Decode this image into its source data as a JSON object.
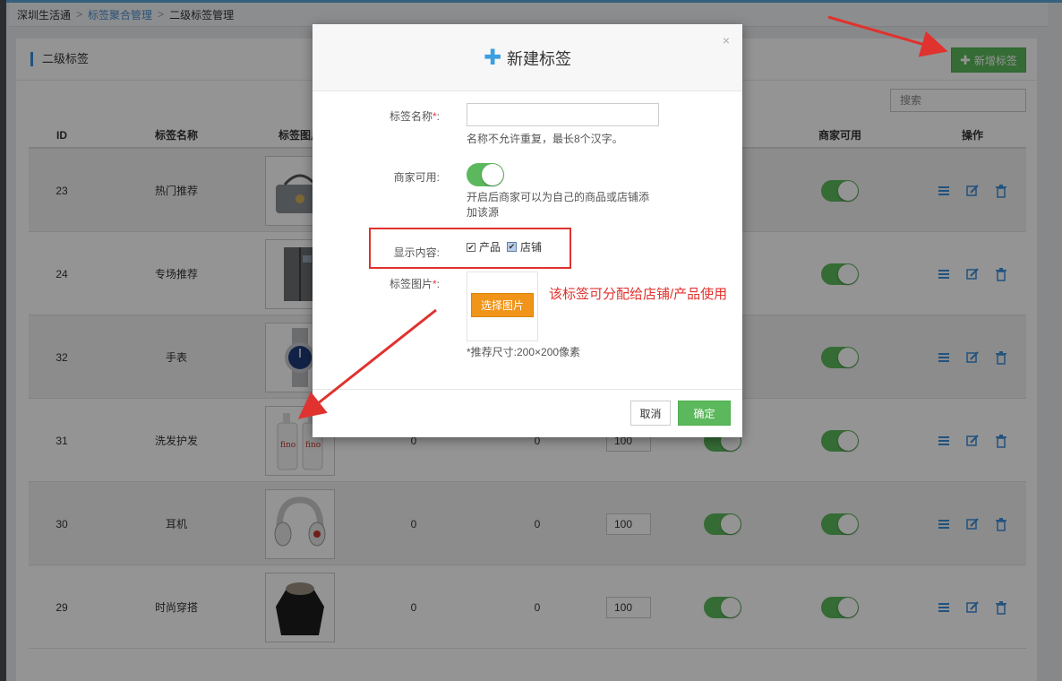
{
  "breadcrumb": {
    "items": [
      "深圳生活通",
      "标签聚合管理",
      "二级标签管理"
    ],
    "separator": ">"
  },
  "panel": {
    "title": "二级标签",
    "add_button": "新增标签",
    "search_placeholder": "搜索"
  },
  "table": {
    "headers": {
      "id": "ID",
      "name": "标签名称",
      "image": "标签图片",
      "merchant": "商家可用",
      "ops": "操作"
    },
    "rows": [
      {
        "id": "23",
        "name": "热门推荐",
        "image_icon": "handbag-image",
        "c1": "",
        "c2": "",
        "sort": "",
        "toggle1": true,
        "toggle2": true
      },
      {
        "id": "24",
        "name": "专场推荐",
        "image_icon": "refrigerator-image",
        "c1": "",
        "c2": "",
        "sort": "",
        "toggle1": true,
        "toggle2": true
      },
      {
        "id": "32",
        "name": "手表",
        "image_icon": "watch-image",
        "c1": "",
        "c2": "",
        "sort": "",
        "toggle1": true,
        "toggle2": true
      },
      {
        "id": "31",
        "name": "洗发护发",
        "image_icon": "shampoo-image",
        "c1": "0",
        "c2": "0",
        "sort": "100",
        "toggle1": true,
        "toggle2": true
      },
      {
        "id": "30",
        "name": "耳机",
        "image_icon": "headphones-image",
        "c1": "0",
        "c2": "0",
        "sort": "100",
        "toggle1": true,
        "toggle2": true
      },
      {
        "id": "29",
        "name": "时尚穿搭",
        "image_icon": "jacket-image",
        "c1": "0",
        "c2": "0",
        "sort": "100",
        "toggle1": true,
        "toggle2": true
      }
    ]
  },
  "modal": {
    "title": "新建标签",
    "close": "×",
    "name_label": "标签名称",
    "required_mark": "*",
    "colon": ":",
    "name_hint": "名称不允许重复，最长8个汉字。",
    "merchant_label": "商家可用:",
    "merchant_hint_1": "开启后商家可以为自己的商品或店铺添",
    "merchant_hint_2": "加该源",
    "display_label": "显示内容:",
    "opt_product": "产品",
    "opt_shop": "店铺",
    "image_label": "标签图片",
    "pick_button": "选择图片",
    "size_hint": "*推荐尺寸:200×200像素",
    "cancel": "取消",
    "ok": "确定"
  },
  "annotation": {
    "note": "该标签可分配给店铺/产品使用"
  },
  "colors": {
    "accent_blue": "#3c8dda",
    "green": "#5cb85c",
    "orange": "#f0941a",
    "annotation_red": "#e0322e"
  }
}
